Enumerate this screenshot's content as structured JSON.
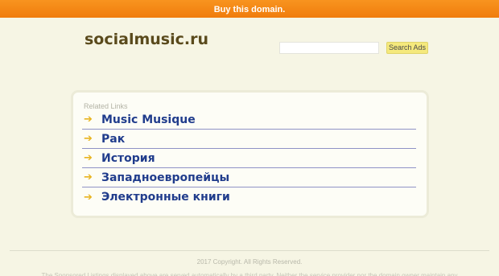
{
  "topbar": {
    "label": "Buy this domain."
  },
  "header": {
    "domain": "socialmusic.ru"
  },
  "search": {
    "placeholder": "",
    "value": "",
    "button_label": "Search Ads"
  },
  "related": {
    "heading": "Related Links",
    "arrow_icon": "arrow-right-icon",
    "arrow_glyph": "➔",
    "links": [
      {
        "label": "Music Musique"
      },
      {
        "label": "Рак"
      },
      {
        "label": "История"
      },
      {
        "label": "Западноевропейцы"
      },
      {
        "label": "Электронные книги"
      }
    ]
  },
  "footer": {
    "copyright": "2017 Copyright. All Rights Reserved.",
    "disclaimer": "The Sponsored Listings displayed above are served automatically by a third party. Neither the service provider nor the domain owner maintain any"
  },
  "colors": {
    "topbar": "#f38a18",
    "background": "#f6f5e4",
    "link": "#203c8c",
    "arrow": "#e8b420",
    "search_button": "#f5e97c",
    "domain_title": "#5a4a1c"
  }
}
